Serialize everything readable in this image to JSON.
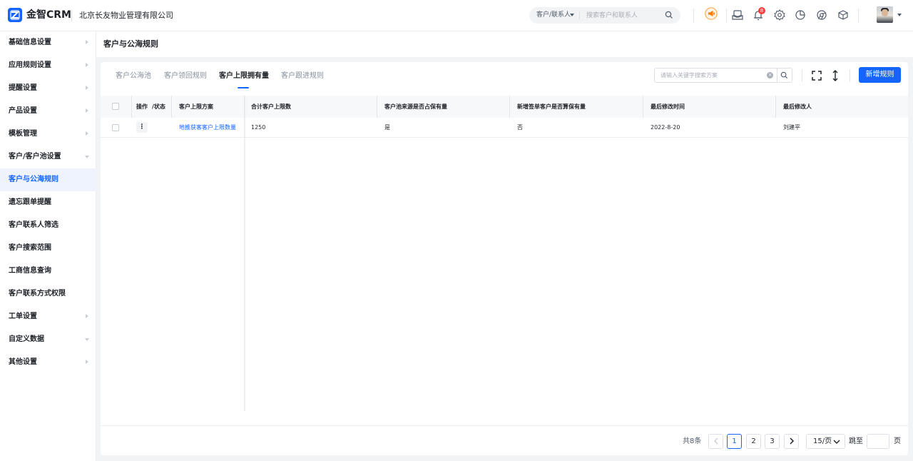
{
  "app": {
    "brand": "金智CRM",
    "company": "北京长友物业管理有限公司"
  },
  "header": {
    "search_type": "客户/联系人",
    "search_placeholder": "搜索客户和联系人",
    "notification_count": "8",
    "icons": [
      "announcement-icon",
      "inbox-icon",
      "bell-icon",
      "gear-icon",
      "pie-chart-icon",
      "chrome-icon",
      "cube-icon"
    ]
  },
  "sidebar": {
    "items": [
      {
        "label": "基础信息设置",
        "arrow": "right"
      },
      {
        "label": "应用规则设置",
        "arrow": "right"
      },
      {
        "label": "提醒设置",
        "arrow": "right"
      },
      {
        "label": "产品设置",
        "arrow": "right"
      },
      {
        "label": "模板管理",
        "arrow": "right"
      },
      {
        "label": "客户/客户池设置",
        "arrow": "down"
      },
      {
        "label": "客户与公海规则",
        "arrow": "",
        "active": true
      },
      {
        "label": "遗忘跟单提醒",
        "arrow": ""
      },
      {
        "label": "客户联系人筛选",
        "arrow": ""
      },
      {
        "label": "客户搜索范围",
        "arrow": ""
      },
      {
        "label": "工商信息查询",
        "arrow": ""
      },
      {
        "label": "客户联系方式权限",
        "arrow": ""
      },
      {
        "label": "工单设置",
        "arrow": "right"
      },
      {
        "label": "自定义数据",
        "arrow": "down"
      },
      {
        "label": "其他设置",
        "arrow": "right"
      }
    ]
  },
  "page": {
    "title": "客户与公海规则"
  },
  "tabs": [
    {
      "label": "客户公海池",
      "active": false
    },
    {
      "label": "客户领回规则",
      "active": false
    },
    {
      "label": "客户上限拥有量",
      "active": true
    },
    {
      "label": "客户跟进规则",
      "active": false
    }
  ],
  "toolbar": {
    "keyword_placeholder": "请输入关键字搜索方案",
    "new_rule_label": "新增规则"
  },
  "table": {
    "columns": [
      "操作",
      "/状态",
      "客户上限方案",
      "合计客户上限数",
      "客户池来源是否占保有量",
      "新增签单客户是否算保有量",
      "最后修改时间",
      "最后修改人"
    ],
    "rows": [
      {
        "ops": "⋮",
        "plan": "地推获客客户上限数量",
        "total": "1250",
        "pool_source": "是",
        "new_signed": "否",
        "modified_time": "2022-8-20",
        "modified_by": "刘建平"
      }
    ]
  },
  "pagination": {
    "total": "共8条",
    "pages": [
      "1",
      "2",
      "3"
    ],
    "current": "1",
    "page_size": "15/页",
    "jump_label": "跳至",
    "page_unit": "页"
  },
  "colors": {
    "primary": "#1664ff",
    "badge": "#f53f3f"
  }
}
